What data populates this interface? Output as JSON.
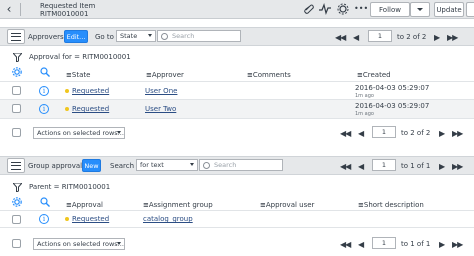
{
  "header": {
    "title": "Requested Item",
    "record": "RITM0010001",
    "follow_label": "Follow",
    "update_label": "Update"
  },
  "approvers": {
    "tab_label": "Approvers",
    "edit_label": "Edit...",
    "goto_label": "Go to",
    "goto_field": "State",
    "search_placeholder": "Search",
    "page_value": "1",
    "page_of": "to 2 of 2",
    "breadcrumb": "Approval for = RITM0010001",
    "columns": [
      "State",
      "Approver",
      "Comments",
      "Created"
    ],
    "rows": [
      {
        "state": "Requested",
        "approver": "User One",
        "comments": "",
        "created": "2016-04-03 05:29:07",
        "created_ago": "1m ago"
      },
      {
        "state": "Requested",
        "approver": "User Two",
        "comments": "",
        "created": "2016-04-03 05:29:07",
        "created_ago": "1m ago"
      }
    ],
    "actions_label": "Actions on selected rows...",
    "footer_page_value": "1",
    "footer_page_of": "to 2 of 2"
  },
  "group_approvals": {
    "tab_label": "Group approvals",
    "new_label": "New",
    "search_label": "Search",
    "search_field": "for text",
    "search_placeholder": "Search",
    "page_value": "1",
    "page_of": "to 1 of 1",
    "breadcrumb": "Parent = RITM0010001",
    "columns": [
      "Approval",
      "Assignment group",
      "Approval user",
      "Short description"
    ],
    "rows": [
      {
        "approval": "Requested",
        "group": "catalog_group",
        "user": "",
        "short_description": ""
      }
    ],
    "actions_label": "Actions on selected rows...",
    "footer_page_value": "1",
    "footer_page_of": "to 1 of 1"
  },
  "icons": {
    "nav_first": "◀◀",
    "nav_prev": "◀",
    "nav_next": "▶",
    "nav_last": "▶▶",
    "info_glyph": "i",
    "more_glyph": "•••"
  },
  "colors": {
    "accent": "#278efc",
    "link": "#2b4d84",
    "state_dot": "#f0c61f",
    "bar_bg": "#e6e8ea"
  }
}
